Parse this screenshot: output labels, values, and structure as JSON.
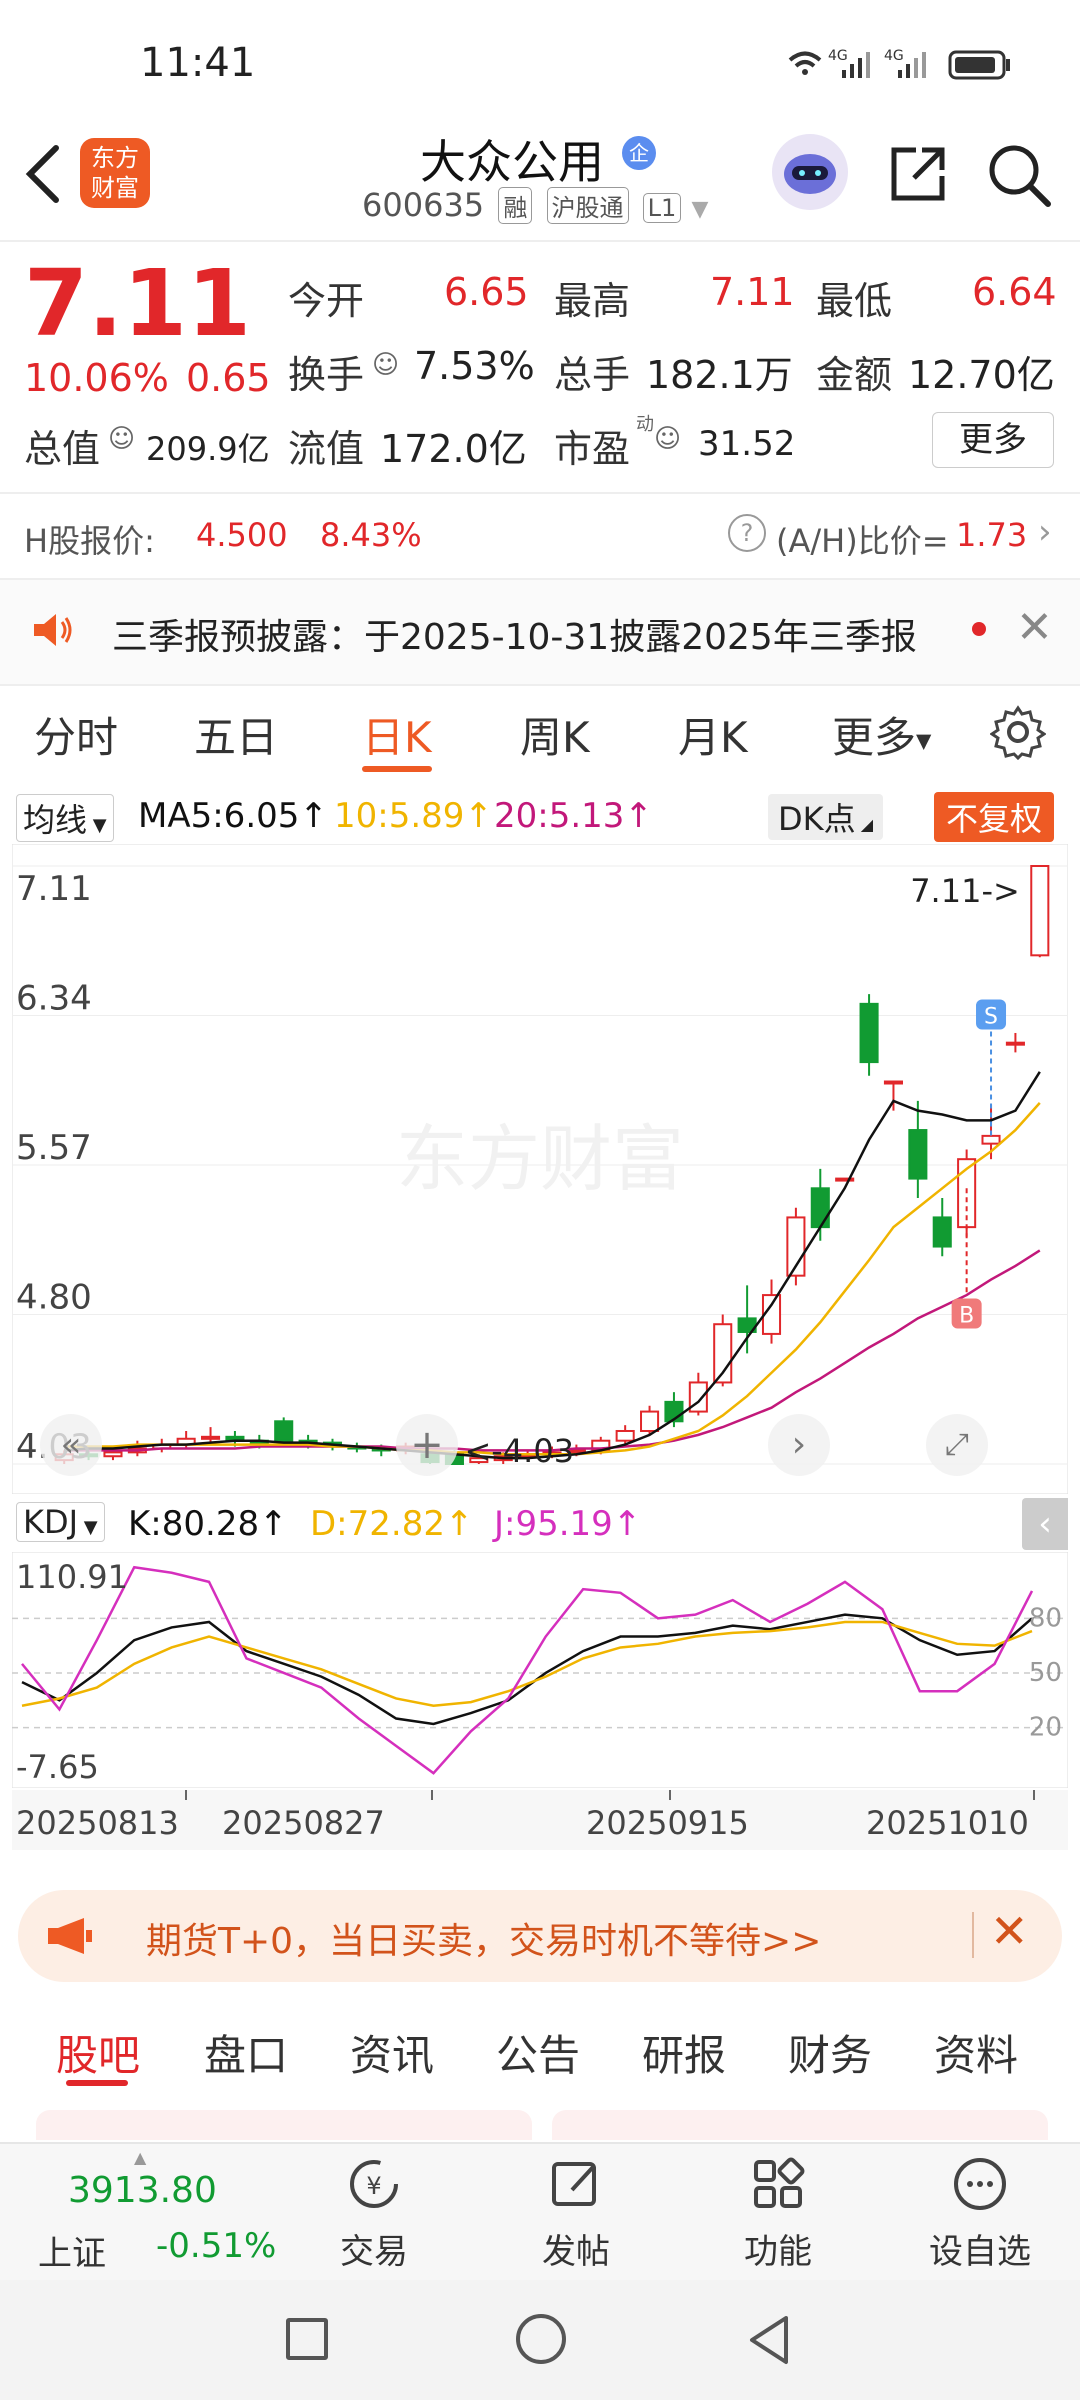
{
  "status_bar": {
    "time": "11:41",
    "icons": "WiFi 4G 4G battery"
  },
  "header": {
    "app_logo": "东方\n财富",
    "stock_name": "大众公用",
    "stock_tag": "企",
    "stock_code": "600635",
    "chips": [
      "融",
      "沪股通",
      "L1"
    ]
  },
  "quote": {
    "price": "7.11",
    "change_pct": "10.06%",
    "change_amt": "0.65",
    "open_label": "今开",
    "open": "6.65",
    "high_label": "最高",
    "high": "7.11",
    "low_label": "最低",
    "low": "6.64",
    "turnover_label": "换手",
    "turnover": "7.53%",
    "volume_label": "总手",
    "volume": "182.1万",
    "amount_label": "金额",
    "amount": "12.70亿",
    "mktcap_label": "总值",
    "mktcap": "209.9亿",
    "float_label": "流值",
    "float": "172.0亿",
    "pe_label": "市盈",
    "pe_sup": "动",
    "pe": "31.52",
    "more": "更多"
  },
  "h_share": {
    "label": "H股报价:",
    "price": "4.500",
    "pct": "8.43%",
    "ratio_label": "(A/H)比价=",
    "ratio": "1.73"
  },
  "notice": {
    "text": "三季报预披露：于2025-10-31披露2025年三季报"
  },
  "period_tabs": [
    "分时",
    "五日",
    "日K",
    "周K",
    "月K",
    "更多"
  ],
  "active_period": "日K",
  "ma": {
    "selector": "均线",
    "ma5": "MA5:6.05↑",
    "ma10": "10:5.89↑",
    "ma20": "20:5.13↑",
    "dk_button": "DK点",
    "adjust_button": "不复权"
  },
  "kdj": {
    "selector": "KDJ",
    "k": "K:80.28↑",
    "d": "D:72.82↑",
    "j": "J:95.19↑"
  },
  "chart_data": [
    {
      "type": "candlestick",
      "ylim": [
        4.03,
        7.11
      ],
      "y_ticks": [
        "7.11",
        "6.34",
        "5.57",
        "4.80",
        "4.03"
      ],
      "annotations": [
        "7.11->",
        "<-4.03",
        "S",
        "B"
      ],
      "watermark": "东方财富",
      "candles": [
        [
          4.05,
          4.08,
          4.03,
          4.1
        ],
        [
          4.08,
          4.07,
          4.05,
          4.1
        ],
        [
          4.07,
          4.09,
          4.05,
          4.12
        ],
        [
          4.09,
          4.11,
          4.07,
          4.15
        ],
        [
          4.11,
          4.13,
          4.09,
          4.16
        ],
        [
          4.13,
          4.16,
          4.11,
          4.2
        ],
        [
          4.16,
          4.17,
          4.13,
          4.22
        ],
        [
          4.17,
          4.15,
          4.12,
          4.2
        ],
        [
          4.15,
          4.14,
          4.11,
          4.18
        ],
        [
          4.25,
          4.15,
          4.13,
          4.27
        ],
        [
          4.15,
          4.14,
          4.11,
          4.18
        ],
        [
          4.14,
          4.12,
          4.1,
          4.16
        ],
        [
          4.12,
          4.11,
          4.09,
          4.14
        ],
        [
          4.11,
          4.1,
          4.07,
          4.13
        ],
        [
          4.1,
          4.12,
          4.08,
          4.14
        ],
        [
          4.08,
          4.04,
          4.03,
          4.1
        ],
        [
          4.08,
          4.03,
          4.03,
          4.1
        ],
        [
          4.04,
          4.06,
          4.03,
          4.08
        ],
        [
          4.05,
          4.07,
          4.03,
          4.09
        ],
        [
          4.07,
          4.08,
          4.05,
          4.1
        ],
        [
          4.08,
          4.09,
          4.06,
          4.12
        ],
        [
          4.09,
          4.1,
          4.07,
          4.13
        ],
        [
          4.1,
          4.15,
          4.08,
          4.17
        ],
        [
          4.15,
          4.2,
          4.12,
          4.23
        ],
        [
          4.2,
          4.3,
          4.18,
          4.33
        ],
        [
          4.35,
          4.25,
          4.22,
          4.4
        ],
        [
          4.3,
          4.45,
          4.28,
          4.5
        ],
        [
          4.45,
          4.75,
          4.43,
          4.8
        ],
        [
          4.78,
          4.71,
          4.6,
          4.95
        ],
        [
          4.7,
          4.9,
          4.65,
          4.98
        ],
        [
          5.0,
          5.3,
          4.95,
          5.35
        ],
        [
          5.45,
          5.25,
          5.18,
          5.55
        ],
        [
          5.5,
          5.5,
          5.5,
          5.5
        ],
        [
          6.4,
          6.1,
          6.03,
          6.45
        ],
        [
          6.0,
          6.0,
          5.85,
          6.0
        ],
        [
          5.75,
          5.5,
          5.4,
          5.9
        ],
        [
          5.3,
          5.15,
          5.1,
          5.4
        ],
        [
          5.25,
          5.6,
          5.2,
          5.65
        ],
        [
          5.68,
          5.72,
          5.6,
          5.88
        ],
        [
          6.2,
          6.2,
          6.15,
          6.25
        ],
        [
          6.65,
          7.11,
          6.64,
          7.11
        ]
      ],
      "ma5": [
        4.1,
        4.11,
        4.11,
        4.12,
        4.13,
        4.13,
        4.14,
        4.15,
        4.15,
        4.14,
        4.14,
        4.13,
        4.12,
        4.11,
        4.1,
        4.09,
        4.08,
        4.07,
        4.06,
        4.06,
        4.07,
        4.08,
        4.1,
        4.13,
        4.18,
        4.26,
        4.35,
        4.5,
        4.68,
        4.85,
        5.05,
        5.25,
        5.45,
        5.7,
        5.9,
        5.85,
        5.83,
        5.8,
        5.8,
        5.85,
        6.05
      ],
      "ma10": [
        4.12,
        4.12,
        4.12,
        4.13,
        4.13,
        4.13,
        4.13,
        4.13,
        4.13,
        4.13,
        4.13,
        4.12,
        4.12,
        4.11,
        4.1,
        4.1,
        4.09,
        4.09,
        4.08,
        4.08,
        4.08,
        4.08,
        4.09,
        4.1,
        4.12,
        4.16,
        4.2,
        4.28,
        4.38,
        4.5,
        4.62,
        4.76,
        4.92,
        5.08,
        5.25,
        5.35,
        5.45,
        5.55,
        5.64,
        5.75,
        5.89
      ],
      "ma20": [
        4.1,
        4.1,
        4.1,
        4.1,
        4.11,
        4.11,
        4.11,
        4.11,
        4.12,
        4.12,
        4.12,
        4.12,
        4.12,
        4.12,
        4.11,
        4.11,
        4.11,
        4.1,
        4.1,
        4.1,
        4.1,
        4.11,
        4.11,
        4.12,
        4.13,
        4.15,
        4.18,
        4.22,
        4.27,
        4.32,
        4.4,
        4.47,
        4.55,
        4.63,
        4.7,
        4.78,
        4.84,
        4.9,
        4.98,
        5.05,
        5.13
      ]
    },
    {
      "type": "line",
      "title": "KDJ",
      "ylim": [
        -7.65,
        110.91
      ],
      "y_ticks": [
        "110.91",
        "-7.65"
      ],
      "ref_lines": [
        80,
        50,
        20
      ],
      "x_labels": [
        "20250813",
        "20250827",
        "20250915",
        "20251010"
      ],
      "series": [
        {
          "name": "K",
          "color": "#111111",
          "values": [
            45,
            35,
            50,
            68,
            75,
            78,
            62,
            55,
            48,
            38,
            25,
            22,
            28,
            35,
            50,
            62,
            70,
            70,
            72,
            76,
            74,
            78,
            82,
            80,
            68,
            60,
            62,
            80
          ]
        },
        {
          "name": "D",
          "color": "#f0b400",
          "values": [
            32,
            36,
            42,
            55,
            64,
            70,
            64,
            58,
            52,
            44,
            36,
            32,
            34,
            40,
            48,
            58,
            64,
            66,
            70,
            72,
            73,
            75,
            78,
            78,
            72,
            66,
            65,
            73
          ]
        },
        {
          "name": "J",
          "color": "#d52fbd",
          "values": [
            55,
            30,
            68,
            108,
            105,
            100,
            58,
            50,
            42,
            25,
            10,
            -5,
            18,
            36,
            70,
            96,
            94,
            80,
            82,
            90,
            78,
            88,
            100,
            85,
            40,
            40,
            55,
            95
          ]
        }
      ]
    }
  ],
  "banner": {
    "text": "期货T+0，当日买卖，交易时机不等待>>"
  },
  "bottom_tabs": [
    "股吧",
    "盘口",
    "资讯",
    "公告",
    "研报",
    "财务",
    "资料"
  ],
  "active_bottom_tab": "股吧",
  "bottom_nav": {
    "index_value": "3913.80",
    "index_name": "上证",
    "index_change": "-0.51%",
    "items": [
      "交易",
      "发帖",
      "功能",
      "设自选"
    ]
  },
  "colors": {
    "up": "#e1272a",
    "down": "#119b32",
    "accent": "#ee5a24",
    "ma5": "#111111",
    "ma10": "#f0b400",
    "ma20": "#c2187a"
  }
}
